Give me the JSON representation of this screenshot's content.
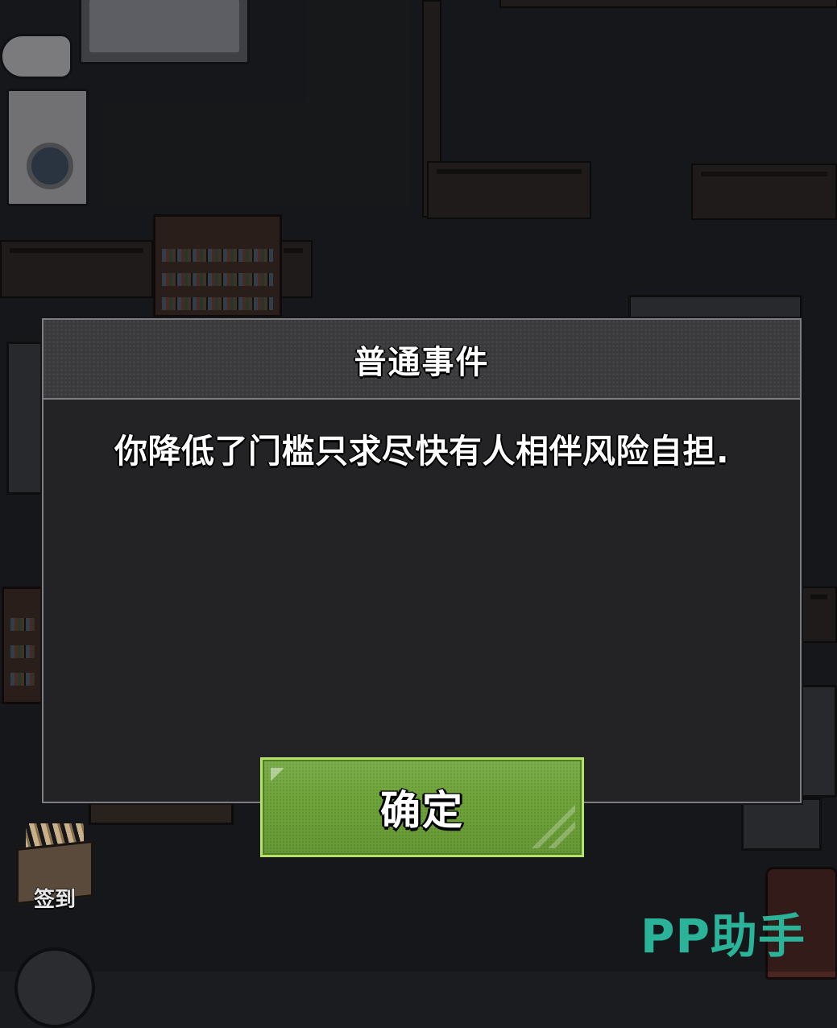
{
  "dialog": {
    "title": "普通事件",
    "message": "你降低了门槛只求尽快有人相伴风险自担.",
    "confirm_label": "确定"
  },
  "hud": {
    "checkin_label": "签到"
  },
  "watermark": "PP助手",
  "colors": {
    "confirm_button": "#6fa53a",
    "confirm_border": "#b5e06a",
    "dialog_bg": "#232325",
    "header_bg": "#3a3a3c",
    "watermark": "#2bb39a"
  }
}
